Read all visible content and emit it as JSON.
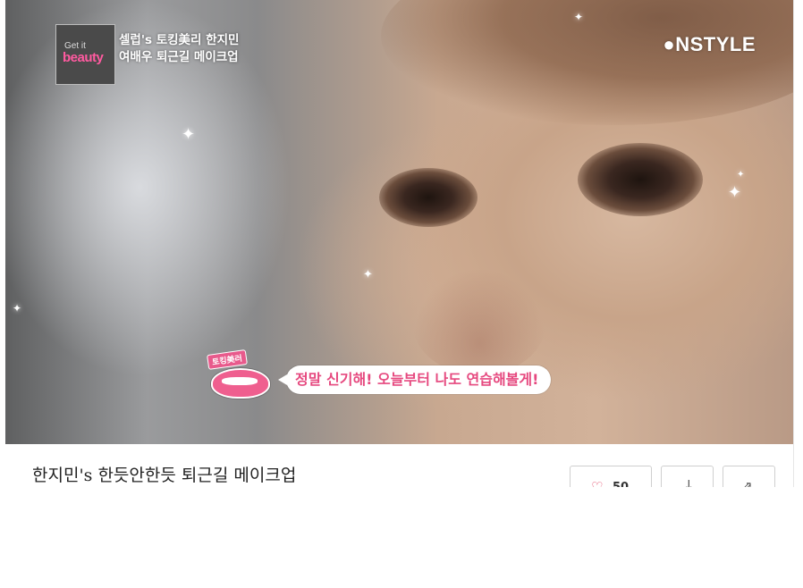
{
  "video": {
    "badge_line1": "Get it",
    "badge_line2": "beauty",
    "show_title_line1": "셀럽's 토킹美리 한지민",
    "show_title_line2": "여배우 퇴근길 메이크업",
    "channel_logo": "●NSTYLE",
    "lips_tag": "토킹美러",
    "subtitle": "정말 신기해! 오늘부터 나도 연습해볼게!",
    "sparkle_glyph": "✦"
  },
  "info": {
    "title": "한지민's 한듯안한듯 퇴근길 메이크업",
    "like_icon": "heart-icon",
    "like_glyph": "♡",
    "like_count": "50",
    "download_icon": "download-icon",
    "download_glyph": "↓",
    "share_icon": "share-icon",
    "share_glyph": "⇗"
  },
  "colors": {
    "accent_pink": "#e6497f",
    "badge_bg": "#4a4a4a",
    "border": "#cfcfcf"
  }
}
